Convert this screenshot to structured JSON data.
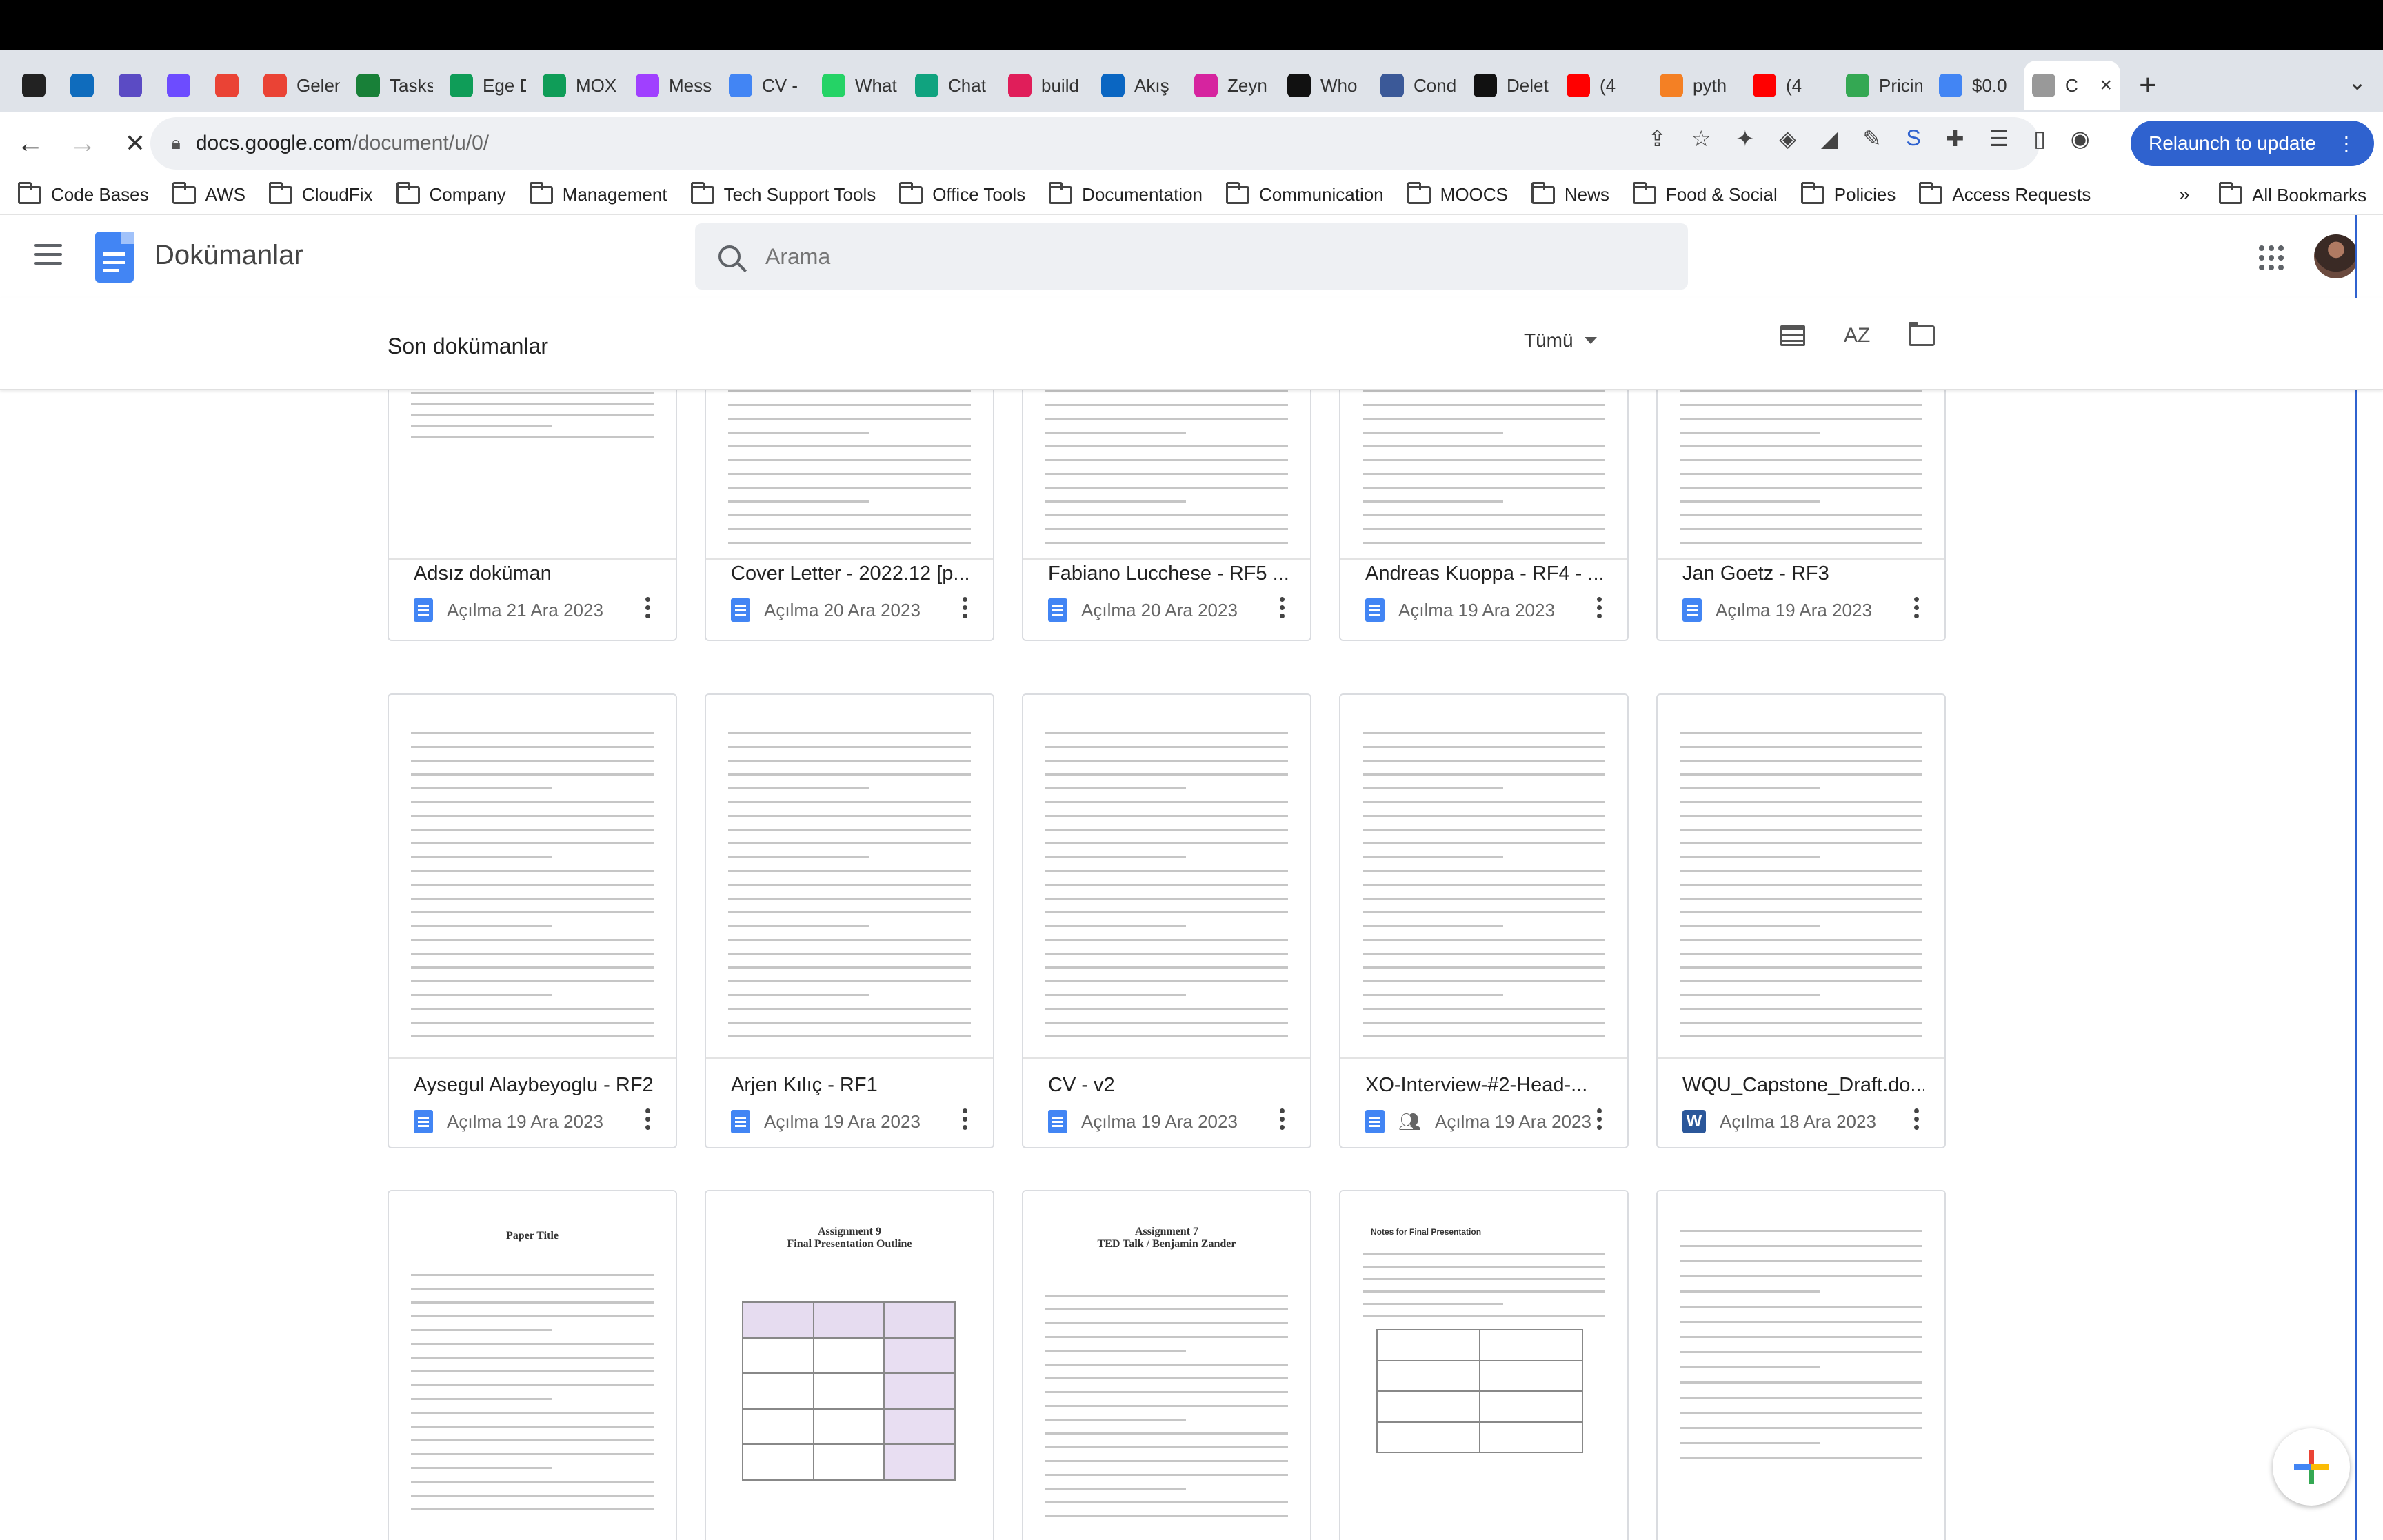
{
  "browser": {
    "tabs": [
      {
        "label": "",
        "icon": "grid-icon",
        "color": "#222222"
      },
      {
        "label": "",
        "icon": "outlook-icon",
        "color": "#0f6cbd"
      },
      {
        "label": "",
        "icon": "circle-icon",
        "color": "#5b4bc4"
      },
      {
        "label": "",
        "icon": "clock-icon",
        "color": "#6d4cff"
      },
      {
        "label": "",
        "icon": "gmail-icon",
        "color": "#ea4335"
      },
      {
        "label": "Gelen",
        "icon": "gmail-icon",
        "color": "#ea4335"
      },
      {
        "label": "Tasks",
        "icon": "tasks-icon",
        "color": "#188038"
      },
      {
        "label": "Ege D",
        "icon": "sheets-icon",
        "color": "#0f9d58"
      },
      {
        "label": "MOX",
        "icon": "sheets-icon",
        "color": "#0f9d58"
      },
      {
        "label": "Mess",
        "icon": "messenger-icon",
        "color": "#a040ff"
      },
      {
        "label": "CV -",
        "icon": "docs-icon",
        "color": "#4285f4"
      },
      {
        "label": "What",
        "icon": "whatsapp-icon",
        "color": "#25d366"
      },
      {
        "label": "Chat",
        "icon": "chatgpt-icon",
        "color": "#10a37f"
      },
      {
        "label": "build",
        "icon": "slack-icon",
        "color": "#e01e5a"
      },
      {
        "label": "Akış",
        "icon": "linkedin-icon",
        "color": "#0a66c2"
      },
      {
        "label": "Zeyn",
        "icon": "instagram-icon",
        "color": "#d6249f"
      },
      {
        "label": "Who",
        "icon": "vercel-icon",
        "color": "#111111"
      },
      {
        "label": "Cond",
        "icon": "condition-icon",
        "color": "#3b5998"
      },
      {
        "label": "Delet",
        "icon": "github-icon",
        "color": "#111111"
      },
      {
        "label": "(4",
        "icon": "youtube-icon",
        "color": "#ff0000"
      },
      {
        "label": "pyth",
        "icon": "stackoverflow-icon",
        "color": "#f48024"
      },
      {
        "label": "(4",
        "icon": "youtube-icon",
        "color": "#ff0000"
      },
      {
        "label": "Pricin",
        "icon": "pricing-icon",
        "color": "#34a853"
      },
      {
        "label": "$0.0",
        "icon": "google-icon",
        "color": "#4285f4"
      },
      {
        "label": "C",
        "icon": "loading-icon",
        "color": "#999999"
      }
    ],
    "new_tab": "+",
    "tab_close": "×",
    "url_host": "docs.google.com",
    "url_path": "/document/u/0/",
    "relaunch_label": "Relaunch to update",
    "bookmarks": [
      "Code Bases",
      "AWS",
      "CloudFix",
      "Company",
      "Management",
      "Tech Support Tools",
      "Office Tools",
      "Documentation",
      "Communication",
      "MOOCS",
      "News",
      "Food & Social",
      "Policies",
      "Access Requests"
    ],
    "bookmarks_more": "»",
    "all_bookmarks": "All Bookmarks"
  },
  "app": {
    "title": "Dokümanlar",
    "search_placeholder": "Arama",
    "section_title": "Son dokümanlar",
    "owner_filter": "Tümü",
    "sort_label": "AZ"
  },
  "documents": [
    {
      "name": "Adsız doküman",
      "meta": "Açılma 21 Ara 2023",
      "type": "doc"
    },
    {
      "name": "Cover Letter - 2022.12 [p...",
      "meta": "Açılma 20 Ara 2023",
      "type": "doc"
    },
    {
      "name": "Fabiano Lucchese - RF5 ...",
      "meta": "Açılma 20 Ara 2023",
      "type": "doc"
    },
    {
      "name": "Andreas Kuoppa - RF4 - ...",
      "meta": "Açılma 19 Ara 2023",
      "type": "doc"
    },
    {
      "name": "Jan Goetz - RF3",
      "meta": "Açılma 19 Ara 2023",
      "type": "doc"
    },
    {
      "name": "Aysegul Alaybeyoglu - RF2",
      "meta": "Açılma 19 Ara 2023",
      "type": "doc"
    },
    {
      "name": "Arjen Kılıç - RF1",
      "meta": "Açılma 19 Ara 2023",
      "type": "doc"
    },
    {
      "name": "CV - v2",
      "meta": "Açılma 19 Ara 2023",
      "type": "doc"
    },
    {
      "name": "XO-Interview-#2-Head-...",
      "meta": "Açılma 19 Ara 2023",
      "type": "doc-shared"
    },
    {
      "name": "WQU_Capstone_Draft.do...",
      "meta": "Açılma 18 Ara 2023",
      "type": "word"
    },
    {
      "name": "",
      "meta": "",
      "type": "doc"
    },
    {
      "name": "",
      "meta": "",
      "type": "doc"
    },
    {
      "name": "",
      "meta": "",
      "type": "doc"
    },
    {
      "name": "",
      "meta": "",
      "type": "doc"
    },
    {
      "name": "",
      "meta": "",
      "type": "doc"
    }
  ],
  "thumb_text": {
    "assignment9_title": "Assignment 9",
    "assignment9_sub": "Final Presentation Outline",
    "assignment7_title": "Assignment 7",
    "assignment7_sub": "TED Talk / Benjamin Zander",
    "paper_title": "Paper Title",
    "notes_title": "Notes for Final Presentation"
  },
  "colors": {
    "accent": "#1a73e8",
    "docs_blue": "#4285f4",
    "relaunch": "#2f62cf"
  }
}
